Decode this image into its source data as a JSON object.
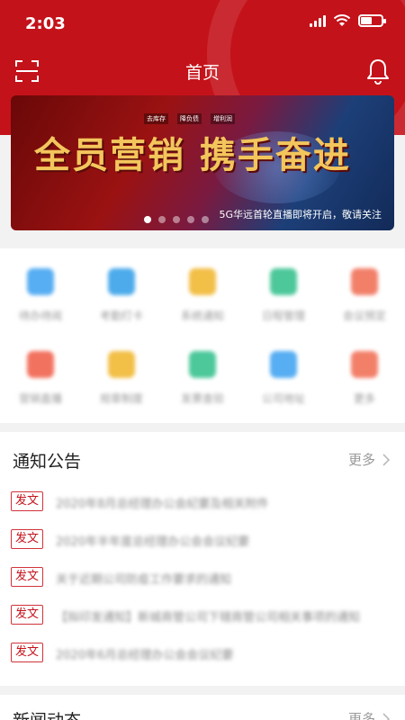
{
  "status_bar": {
    "time": "2:03"
  },
  "nav": {
    "title": "首页"
  },
  "banner": {
    "title": "全员营销 携手奋进",
    "tags": [
      "去库存",
      "降负债",
      "增利润"
    ],
    "caption": "5G华远首轮直播即将开启，敬请关注",
    "slide_count": 5,
    "active_slide": 0
  },
  "grid": {
    "items": [
      {
        "label": "待办待阅",
        "color": "#3aa0f0"
      },
      {
        "label": "考勤打卡",
        "color": "#2f9de8"
      },
      {
        "label": "系统通知",
        "color": "#f0b428"
      },
      {
        "label": "日程管理",
        "color": "#2fbf8a"
      },
      {
        "label": "会议预定",
        "color": "#f06a50"
      },
      {
        "label": "营销直播",
        "color": "#f05a45"
      },
      {
        "label": "规章制度",
        "color": "#f0b428"
      },
      {
        "label": "发票查验",
        "color": "#2fbf8a"
      },
      {
        "label": "公司地址",
        "color": "#3aa0f0"
      },
      {
        "label": "更多",
        "color": "#f06a50"
      }
    ]
  },
  "notices": {
    "title": "通知公告",
    "more": "更多",
    "items": [
      {
        "tag": "发文",
        "text": "2020年8月总经理办公会纪要及相关附件"
      },
      {
        "tag": "发文",
        "text": "2020年半年度总经理办公会会议纪要"
      },
      {
        "tag": "发文",
        "text": "关于近期公司防疫工作要求的通知"
      },
      {
        "tag": "发文",
        "text": "【拟印发通知】新城商管公司下辖商管公司相关事项的通知"
      },
      {
        "tag": "发文",
        "text": "2020年6月总经理办公会会议纪要"
      }
    ]
  },
  "news": {
    "title": "新闻动态",
    "more": "更多"
  },
  "colors": {
    "brand_red": "#c4121a"
  }
}
